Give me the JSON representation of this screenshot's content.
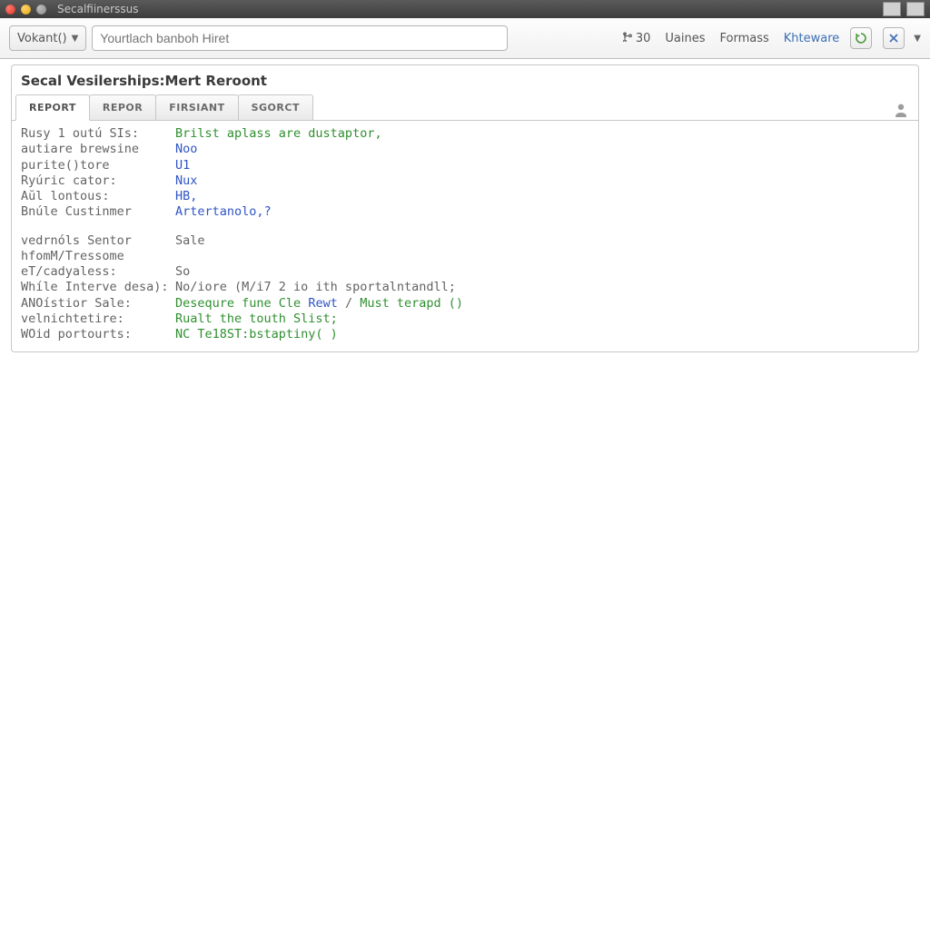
{
  "titlebar": {
    "title": "Secalfiinerssus"
  },
  "toolbar": {
    "combo_label": "Vokant()",
    "search_placeholder": "Yourtlach banboh Hiret",
    "count_badge": "30",
    "link_values": "Uaines",
    "link_formats": "Formass",
    "link_kiteware": "Khteware"
  },
  "panel": {
    "title": "Secal Vesilerships:Mert Reroont",
    "tabs": [
      {
        "label": "REPORT",
        "active": true
      },
      {
        "label": "REPOR",
        "active": false
      },
      {
        "label": "FIRSIANT",
        "active": false
      },
      {
        "label": "SGORCT",
        "active": false
      }
    ],
    "rows": [
      {
        "label": "Rusy 1 outú SIs:",
        "segs": [
          {
            "t": "Brilst aplass are dustaptor,",
            "c": "g"
          }
        ]
      },
      {
        "label": "autiare brewsine",
        "segs": [
          {
            "t": "Noo",
            "c": "b"
          }
        ]
      },
      {
        "label": "purite()tore",
        "segs": [
          {
            "t": "U1",
            "c": "b"
          }
        ]
      },
      {
        "label": "Ryúric cator:",
        "segs": [
          {
            "t": "Nux",
            "c": "b"
          }
        ]
      },
      {
        "label": "Aŭl lontous:",
        "segs": [
          {
            "t": "HB,",
            "c": "b"
          }
        ]
      },
      {
        "label": "Bnúle Custinmer",
        "segs": [
          {
            "t": "Artertanolo,?",
            "c": "b"
          }
        ]
      },
      {
        "blank": true
      },
      {
        "label": "vedrnóls Sentor",
        "segs": [
          {
            "t": "Sale",
            "c": "gr"
          }
        ]
      },
      {
        "label": "hfomM/Tressome",
        "segs": []
      },
      {
        "label": "eT/cadyaless:",
        "segs": [
          {
            "t": "So",
            "c": "gr"
          }
        ]
      },
      {
        "label": "Whíle Interve desa):",
        "segs": [
          {
            "t": "No/iore (M/i7 2 io ith sportalntandll;",
            "c": "gr"
          }
        ]
      },
      {
        "label": "ANOístior Sale:",
        "segs": [
          {
            "t": "Desequre fune Cle ",
            "c": "g"
          },
          {
            "t": "Rewt",
            "c": "b"
          },
          {
            "t": " / ",
            "c": "gr"
          },
          {
            "t": "Must terapd ()",
            "c": "g"
          }
        ]
      },
      {
        "label": "velnichtetire:",
        "segs": [
          {
            "t": "Rualt the touth Slist;",
            "c": "g"
          }
        ]
      },
      {
        "label": "WOid portourts:",
        "segs": [
          {
            "t": "NC Te18ST:bstaptiny( )",
            "c": "g"
          }
        ]
      }
    ]
  }
}
